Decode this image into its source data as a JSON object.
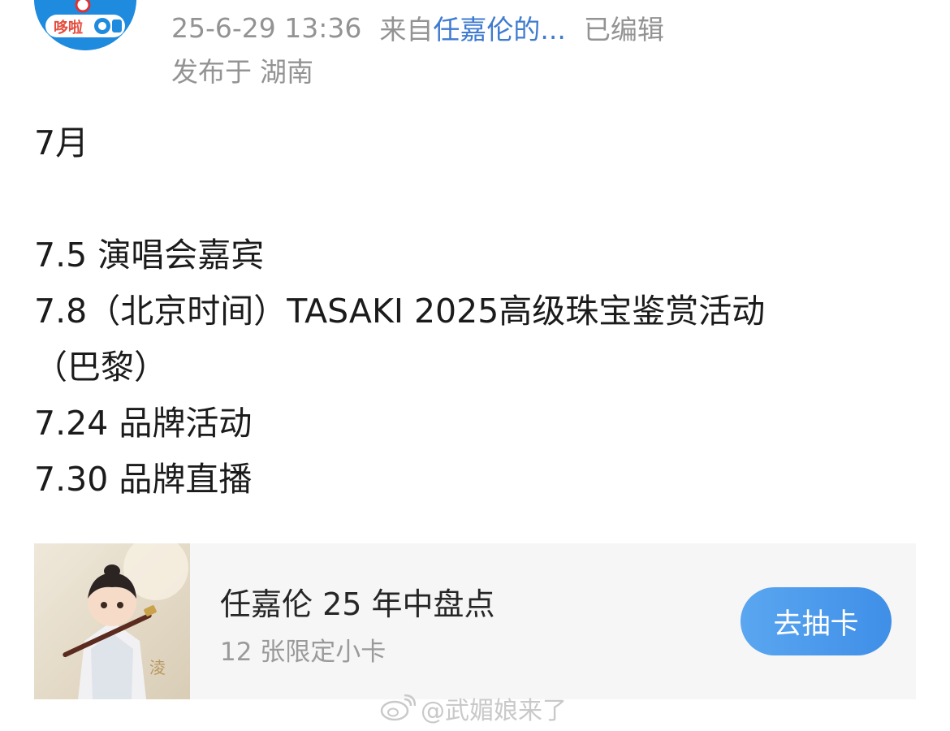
{
  "post": {
    "meta": {
      "timestamp": "25-6-29 13:36",
      "source_prefix": "来自",
      "source_name": "任嘉伦的...",
      "edited": "已编辑",
      "location_prefix": "发布于",
      "location": "湖南"
    },
    "body_lines": [
      "7月",
      "",
      "7.5  演唱会嘉宾",
      "7.8（北京时间）TASAKI 2025高级珠宝鉴赏活动",
      "（巴黎）",
      "7.24 品牌活动",
      "7.30 品牌直播"
    ]
  },
  "card": {
    "title": "任嘉伦 25 年中盘点",
    "subtitle": "12 张限定小卡",
    "button_label": "去抽卡"
  },
  "avatar": {
    "badge_text": "哆啦",
    "icon": "doraemon-pocket-icon"
  },
  "watermark": {
    "text": "@武媚娘来了",
    "icon": "weibo-logo-icon"
  },
  "colors": {
    "meta_gray": "#939393",
    "link_blue": "#3f7bd0",
    "button_blue": "#4a96ec",
    "card_bg": "#f6f6f6"
  }
}
